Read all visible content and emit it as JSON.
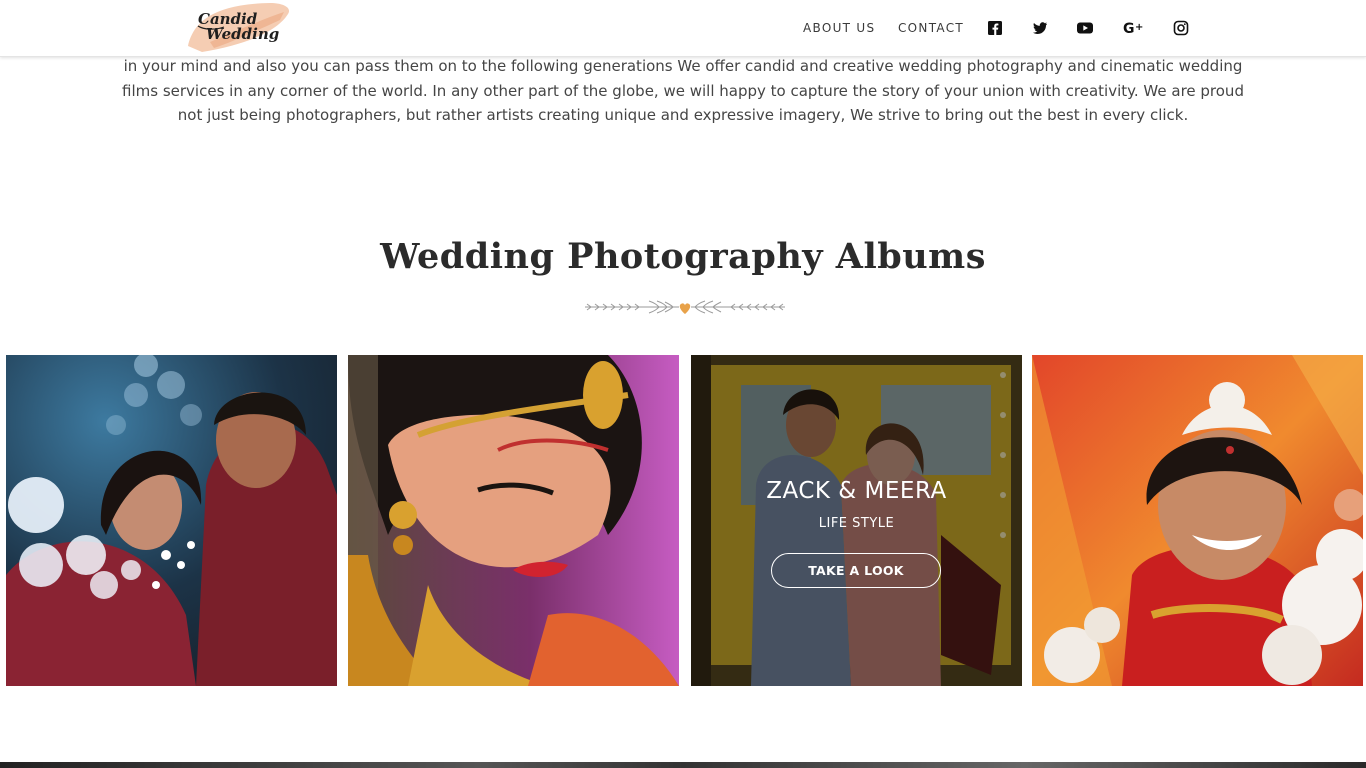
{
  "header": {
    "logo_text": "Candid Wedding",
    "nav": [
      {
        "label": "ABOUT US"
      },
      {
        "label": "CONTACT"
      }
    ],
    "social_icons": [
      "facebook-icon",
      "twitter-icon",
      "youtube-icon",
      "google-plus-icon",
      "instagram-icon"
    ]
  },
  "intro": {
    "text": "in your mind and also you can pass them on to the following generations We offer candid and creative wedding photography and cinematic wedding films services in any corner of the world. In any other part of the globe, we will happy to capture the story of your union with creativity. We are proud not just being photographers, but rather artists creating unique and expressive imagery, We strive to bring out the best in every click."
  },
  "section": {
    "title": "Wedding Photography Albums"
  },
  "albums": [
    {
      "title": "",
      "subtitle": "",
      "button": ""
    },
    {
      "title": "",
      "subtitle": "",
      "button": ""
    },
    {
      "title": "ZACK & MEERA",
      "subtitle": "LIFE STYLE",
      "button": "TAKE A LOOK"
    },
    {
      "title": "",
      "subtitle": "",
      "button": ""
    }
  ],
  "colors": {
    "accent": "#e8a24a",
    "text": "#454545",
    "heading": "#2b2b2b"
  }
}
